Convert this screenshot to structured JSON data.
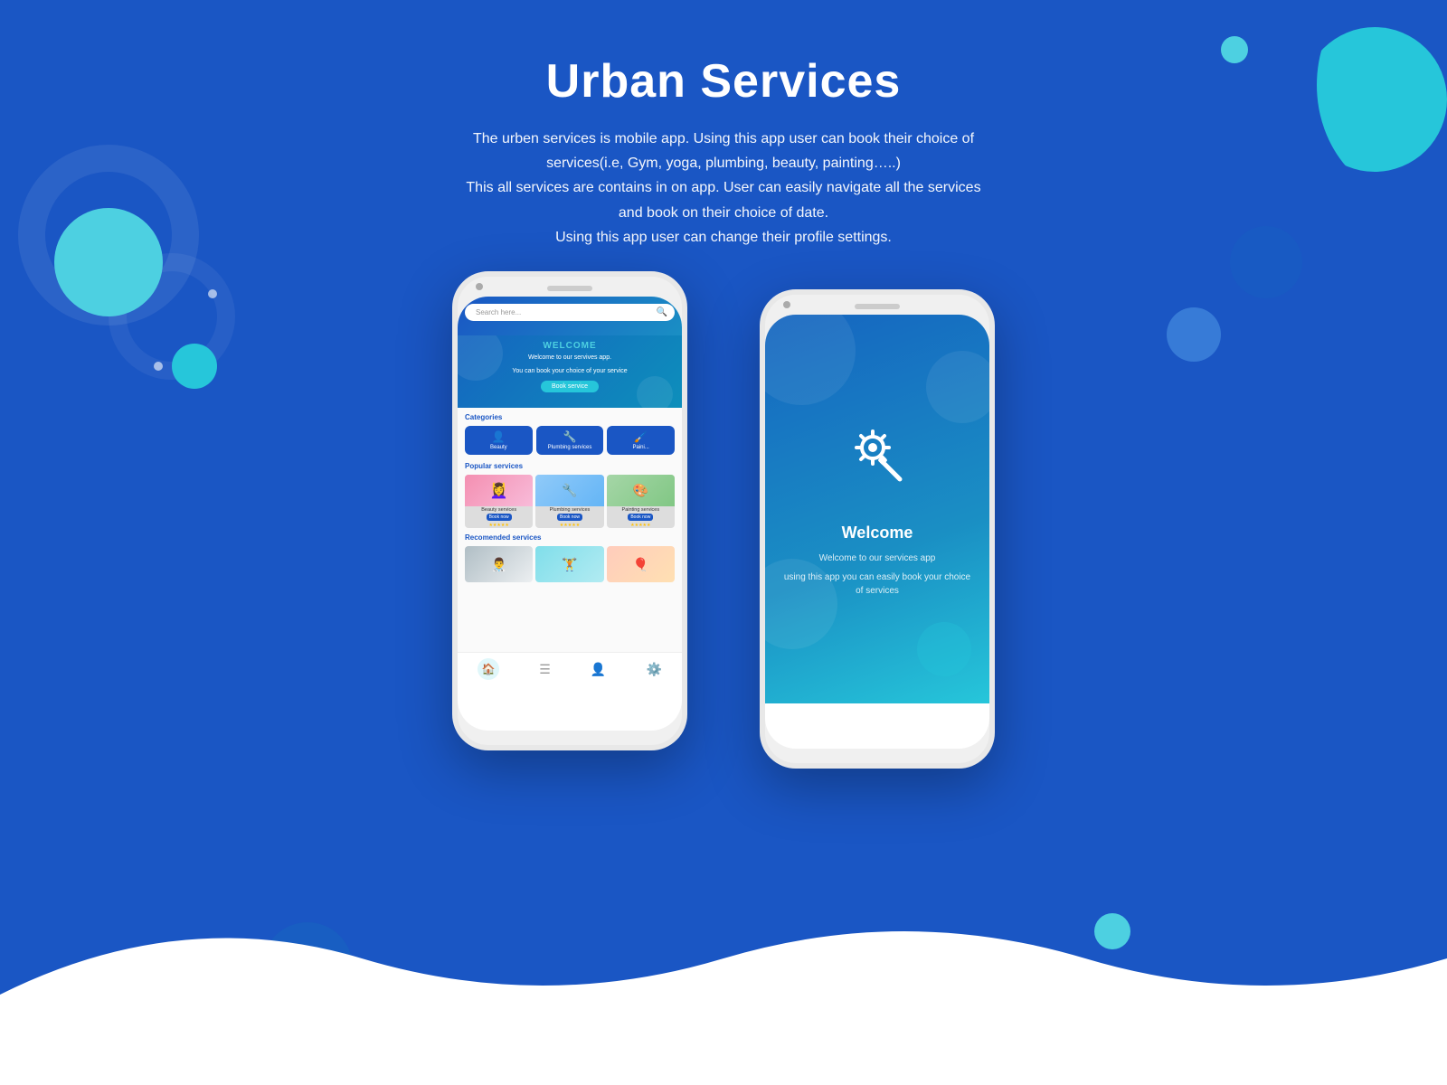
{
  "header": {
    "title": "Urban Services",
    "description_line1": "The urben services is mobile app. Using this app user can book their choice of",
    "description_line2": "services(i.e, Gym, yoga, plumbing, beauty, painting…..)",
    "description_line3": "This all services are contains in on app. User can easily navigate all the services",
    "description_line4": "and book on their choice of date.",
    "description_line5": "Using this app user can change their profile settings."
  },
  "phone1": {
    "search_placeholder": "Search here...",
    "welcome_title": "WELCOME",
    "welcome_sub1": "Welcome to our servives app.",
    "welcome_sub2": "You can book your choice of your service",
    "book_button": "Book service",
    "categories_title": "Categories",
    "categories": [
      {
        "icon": "👤",
        "label": "Beauty"
      },
      {
        "icon": "🔧",
        "label": "Plumbing services"
      },
      {
        "icon": "🖌️",
        "label": "Paini..."
      }
    ],
    "popular_title": "Popular services",
    "popular_items": [
      {
        "label": "Beauty services",
        "stars": "★★★★★"
      },
      {
        "label": "Plumbing services",
        "stars": "★★★★★"
      },
      {
        "label": "Painting services",
        "stars": "★★★★★"
      }
    ],
    "recomended_title": "Recomended services",
    "nav_items": [
      "home",
      "list",
      "profile",
      "settings"
    ]
  },
  "phone2": {
    "welcome_title": "Welcome",
    "welcome_sub": "Welcome to our services app",
    "welcome_desc": "using this app you can easily book your choice of services"
  }
}
